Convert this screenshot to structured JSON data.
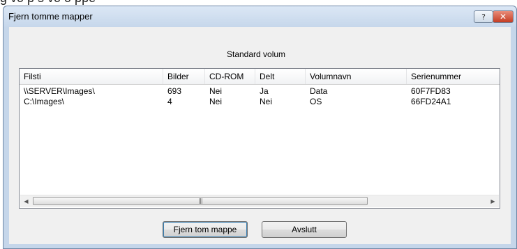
{
  "window": {
    "title": "Fjern tomme mapper",
    "help_label": "?",
    "close_label": "✕"
  },
  "top_strip_text": "g     vo  p  s     vo   o   ppe",
  "volume_label": "Standard volum",
  "table": {
    "columns": [
      "Filsti",
      "Bilder",
      "CD-ROM",
      "Delt",
      "Volumnavn",
      "Serienummer"
    ],
    "rows": [
      [
        "\\\\SERVER\\Images\\",
        "693",
        "Nei",
        "Ja",
        "Data",
        "60F7FD83"
      ],
      [
        "C:\\Images\\",
        "4",
        "Nei",
        "Nei",
        "OS",
        "66FD24A1"
      ]
    ]
  },
  "scrollbar": {
    "left_arrow": "◀",
    "right_arrow": "▶",
    "grip": "|||"
  },
  "buttons": {
    "remove": "Fjern tom mappe",
    "exit": "Avslutt"
  }
}
